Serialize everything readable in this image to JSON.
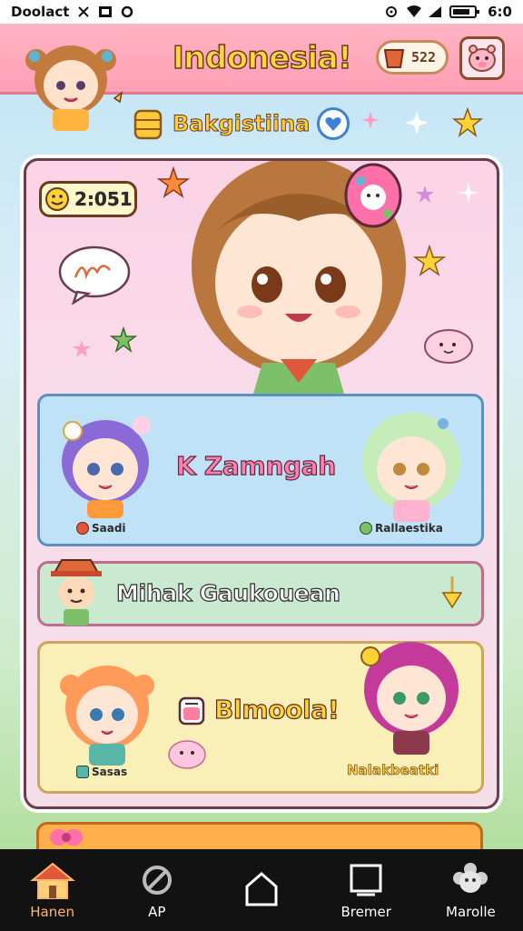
{
  "status_bar": {
    "carrier": "Doolact",
    "time": "6:0"
  },
  "header": {
    "title": "Indonesia!",
    "coins": "522"
  },
  "subheader": {
    "label": "Bakgistiina"
  },
  "main": {
    "timer": "2:051",
    "row_blue": {
      "title": "K Zamngah",
      "left_tag": "Saadi",
      "right_tag": "Rallaestika"
    },
    "row_green": {
      "title": "Mihak Gaukouean"
    },
    "row_yellow": {
      "title": "Blmoola!",
      "left_tag": "Sasas",
      "right_tag": "Nalakbeatki"
    }
  },
  "bottom_nav": {
    "items": [
      {
        "label": "Hanen",
        "icon": "house-icon",
        "active": true
      },
      {
        "label": "AP",
        "icon": "wrench-icon",
        "active": false
      },
      {
        "label": "",
        "icon": "home-outline-icon",
        "active": false
      },
      {
        "label": "Bremer",
        "icon": "tv-icon",
        "active": false
      },
      {
        "label": "Marolle",
        "icon": "flower-icon",
        "active": false
      }
    ]
  },
  "colors": {
    "header_bg": "#ff9fb6",
    "title_yellow": "#ffd640",
    "card_pink": "#fbd3e6",
    "row_blue": "#bfe2f7",
    "row_green": "#c9ead0",
    "row_yellow": "#fbefb8",
    "nav_bg": "#121212"
  }
}
